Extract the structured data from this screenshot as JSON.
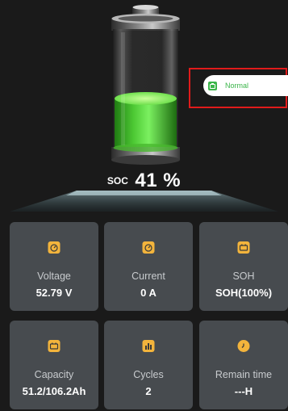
{
  "status": {
    "label": "Normal",
    "icon": "battery-status-icon",
    "color": "#3bb54a",
    "highlight_color": "#e01b1b"
  },
  "soc": {
    "label": "SOC",
    "value": "41 %",
    "level": 0.41
  },
  "cards": [
    {
      "label": "Voltage",
      "value": "52.79 V",
      "icon": "gauge-icon"
    },
    {
      "label": "Current",
      "value": "0 A",
      "icon": "gauge-icon"
    },
    {
      "label": "SOH",
      "value": "SOH(100%)",
      "icon": "battery-icon"
    },
    {
      "label": "Capacity",
      "value": "51.2/106.2Ah",
      "icon": "battery-icon"
    },
    {
      "label": "Cycles",
      "value": "2",
      "icon": "bar-chart-icon"
    },
    {
      "label": "Remain time",
      "value": "---H",
      "icon": "clock-icon"
    }
  ],
  "colors": {
    "background": "#1a1a1a",
    "card": "#474b4f",
    "icon_accent": "#f3b43c",
    "battery_fill": "#5be040"
  }
}
